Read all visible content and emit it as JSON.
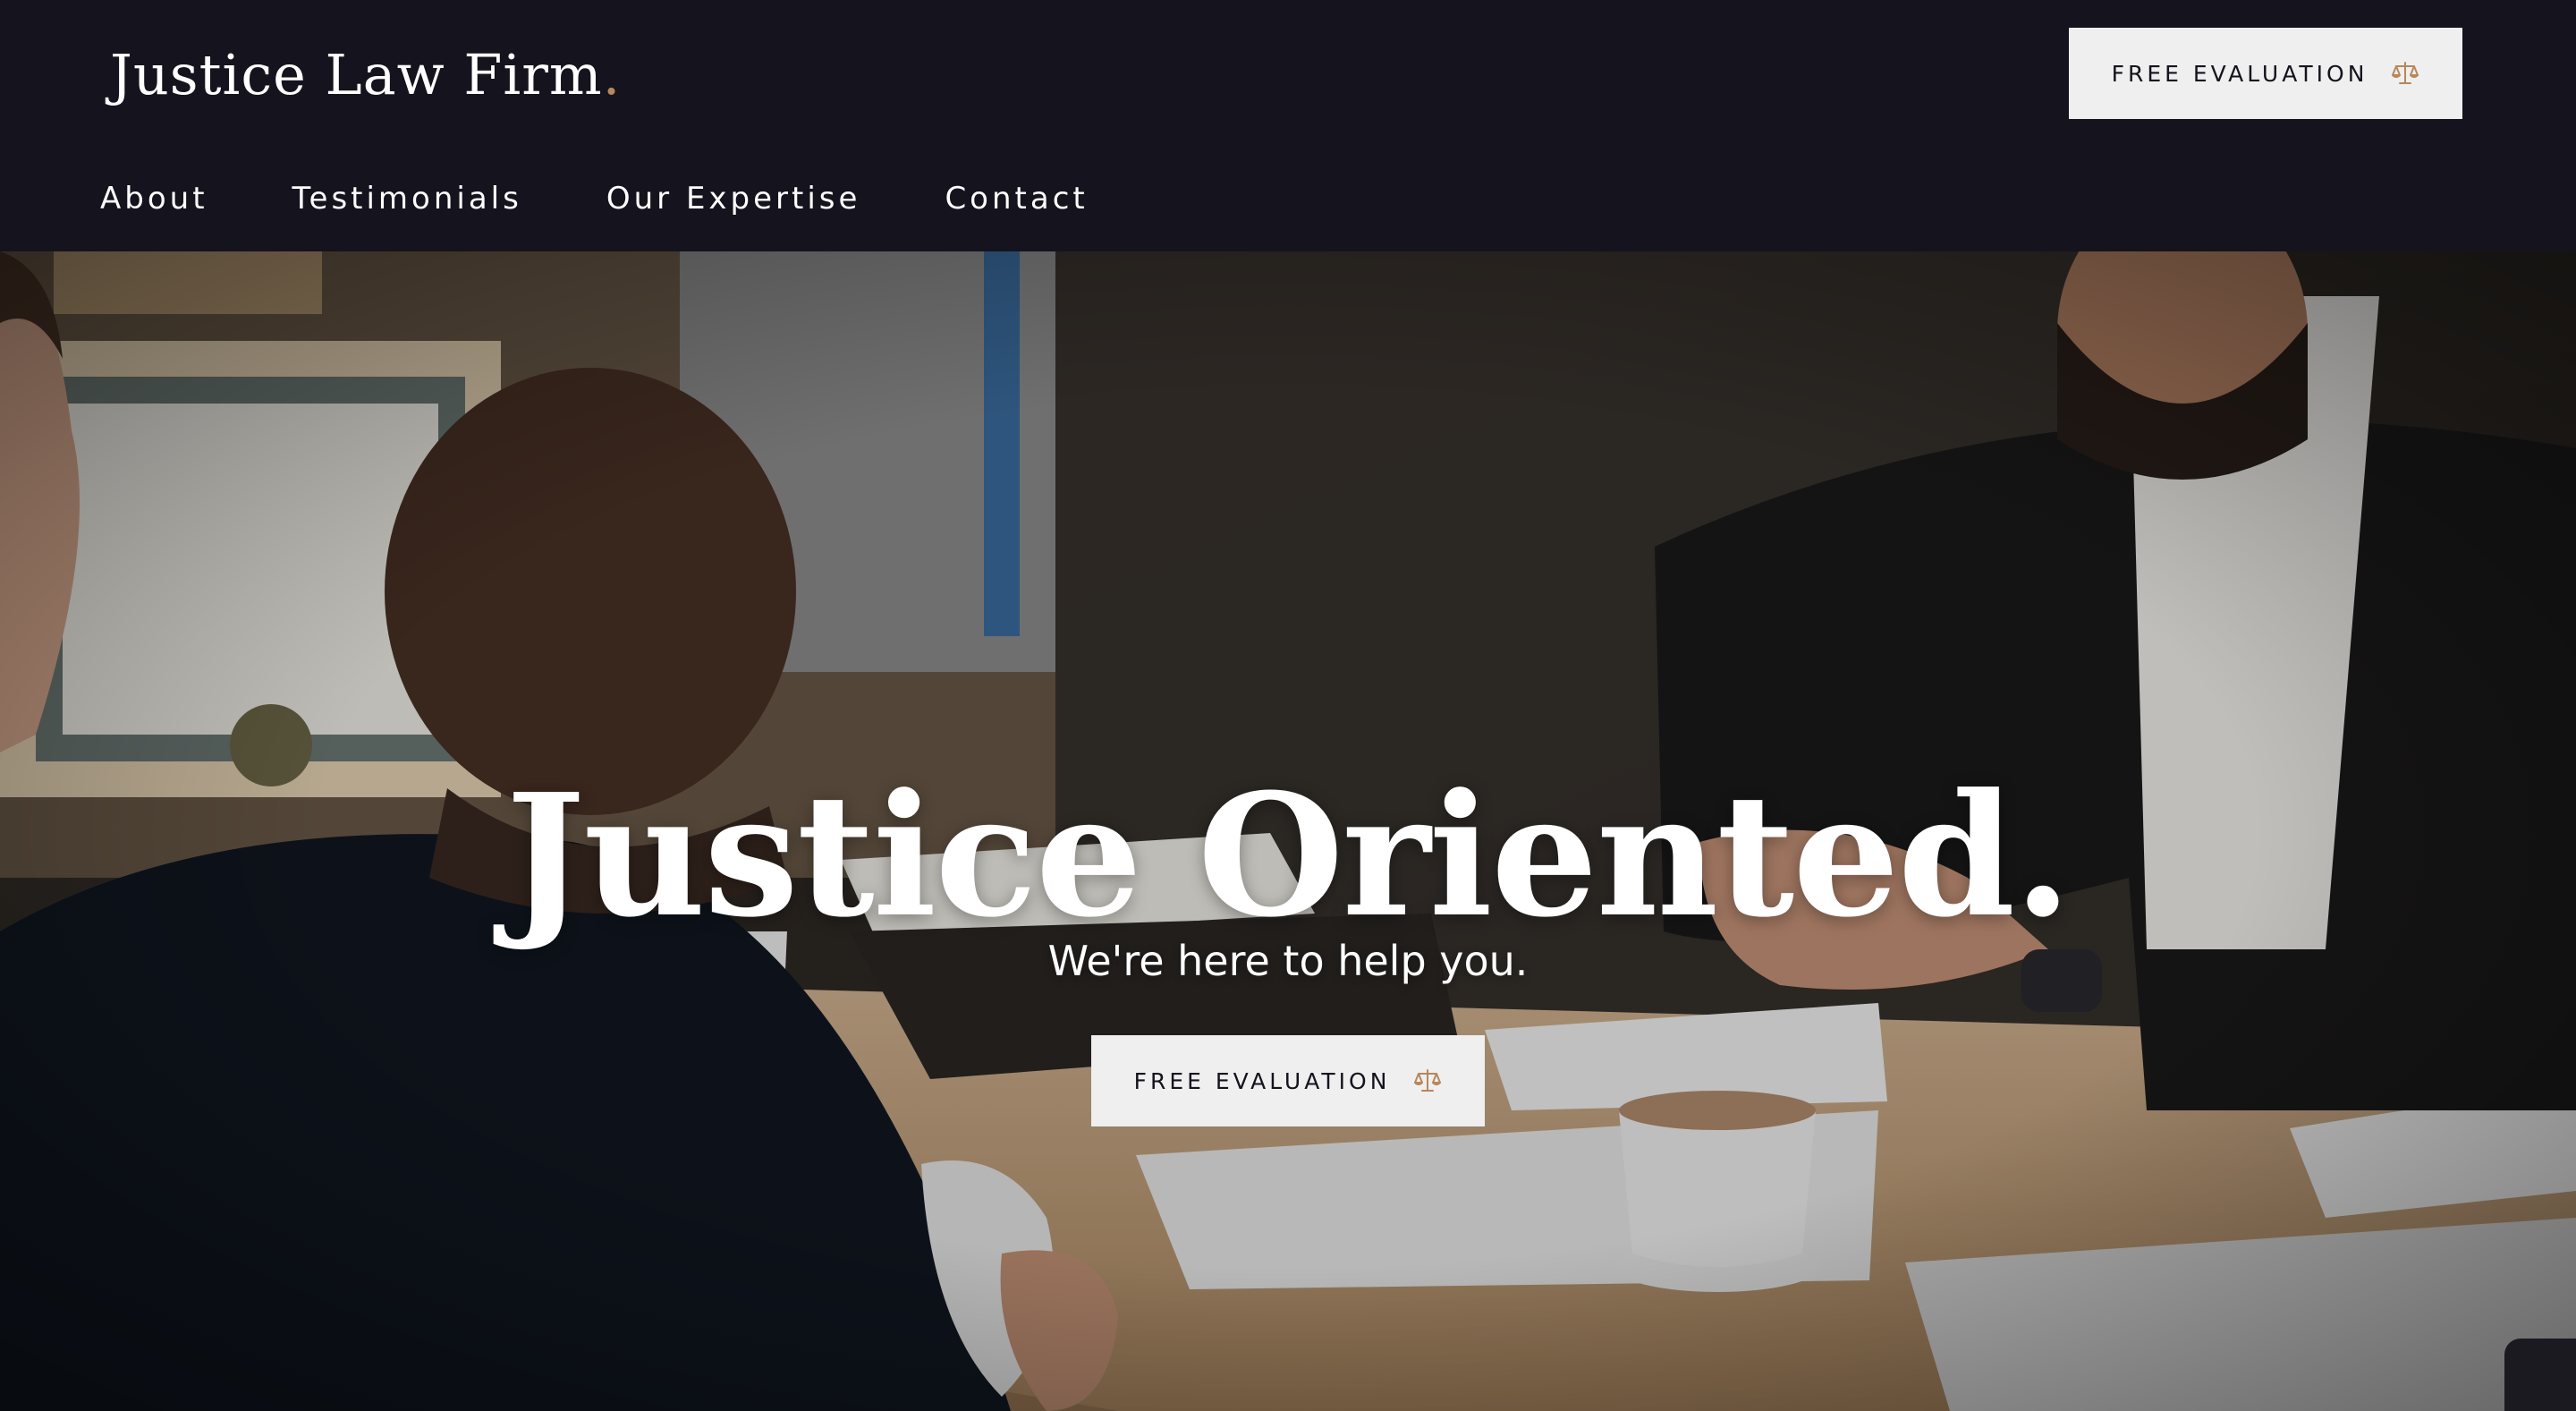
{
  "header": {
    "logo_text": "Justice Law Firm",
    "logo_dot": ".",
    "cta_label": "FREE EVALUATION",
    "cta_icon": "scale-icon"
  },
  "nav": {
    "items": [
      {
        "label": "About"
      },
      {
        "label": "Testimonials"
      },
      {
        "label": "Our Expertise"
      },
      {
        "label": "Contact"
      }
    ]
  },
  "hero": {
    "title": "Justice Oriented.",
    "subtitle": "We're here to help you.",
    "cta_label": "FREE EVALUATION",
    "cta_icon": "scale-icon",
    "image_description": "meeting-at-law-office"
  },
  "colors": {
    "header_bg": "#15131d",
    "button_bg": "#efefef",
    "button_text": "#15131d",
    "accent": "#b8875a",
    "text_light": "#ffffff"
  }
}
